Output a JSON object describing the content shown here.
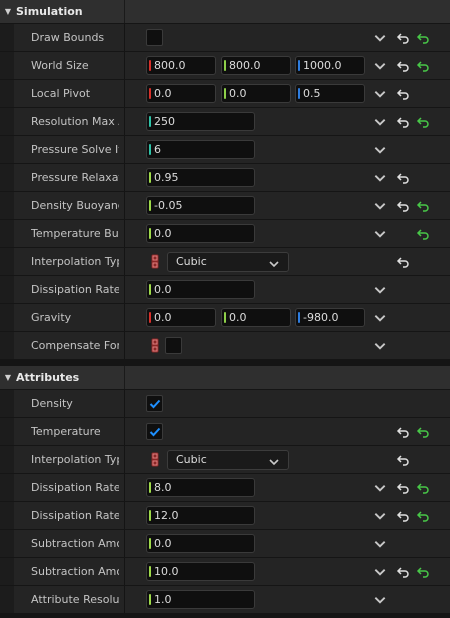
{
  "sections": [
    {
      "title": "Simulation"
    },
    {
      "title": "Attributes"
    }
  ],
  "simulation": {
    "draw_bounds": {
      "label": "Draw Bounds"
    },
    "world_size": {
      "label": "World Size",
      "x": "800.0",
      "y": "800.0",
      "z": "1000.0"
    },
    "local_pivot": {
      "label": "Local Pivot",
      "x": "0.0",
      "y": "0.0",
      "z": "0.5"
    },
    "resolution_max": {
      "label": "Resolution Max A",
      "value": "250"
    },
    "pressure_solve": {
      "label": "Pressure Solve Ite",
      "value": "6"
    },
    "pressure_relax": {
      "label": "Pressure Relaxati",
      "value": "0.95"
    },
    "density_buoyancy": {
      "label": "Density Buoyancy",
      "value": "-0.05"
    },
    "temperature_buoy": {
      "label": "Temperature Buoy",
      "value": "0.0"
    },
    "interp_type": {
      "label": "Interpolation Type",
      "value": "Cubic"
    },
    "dissipation_rate": {
      "label": "Dissipation Rate",
      "value": "0.0"
    },
    "gravity": {
      "label": "Gravity",
      "x": "0.0",
      "y": "0.0",
      "z": "-980.0"
    },
    "compensate": {
      "label": "Compensate For A"
    }
  },
  "attributes": {
    "density": {
      "label": "Density"
    },
    "temperature": {
      "label": "Temperature"
    },
    "interp_type": {
      "label": "Interpolation Type",
      "value": "Cubic"
    },
    "dissipation_d": {
      "label": "Dissipation Rate D",
      "value": "8.0"
    },
    "dissipation_t": {
      "label": "Dissipation Rate T",
      "value": "12.0"
    },
    "subtraction_1": {
      "label": "Subtraction Amou",
      "value": "0.0"
    },
    "subtraction_2": {
      "label": "Subtraction Amou",
      "value": "10.0"
    },
    "attribute_res": {
      "label": "Attribute Resoluti",
      "value": "1.0"
    }
  },
  "colors": {
    "reset_arrow": "#e0e0e0",
    "revert_arrow": "#48c848",
    "checkmark": "#1e90ff"
  }
}
